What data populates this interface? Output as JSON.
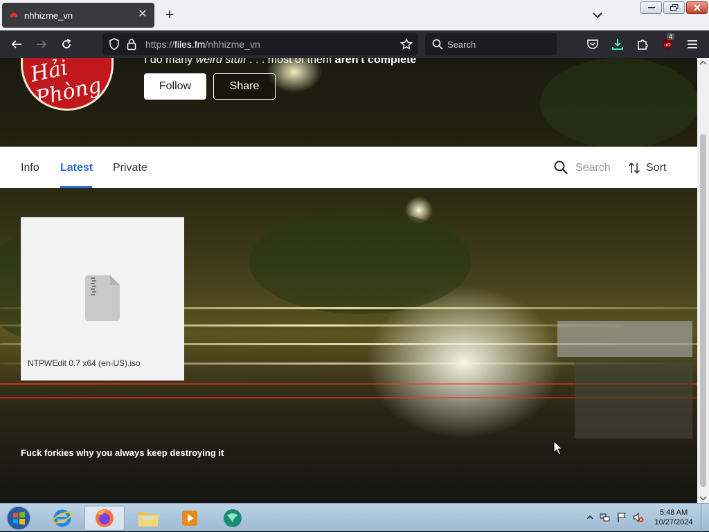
{
  "browser": {
    "tab_title": "nhhizme_vn",
    "url_prefix": "https://",
    "url_host": "files.fm",
    "url_path": "/nhhizme_vn",
    "search_placeholder": "Search",
    "extension_badge": "4"
  },
  "profile": {
    "avatar_text": "Hải Phòng",
    "tagline_prefix": "I do many ",
    "tagline_italic": "weird stuff",
    "tagline_mid": " . . . most of them ",
    "tagline_bold": "aren't complete",
    "follow_label": "Follow",
    "share_label": "Share"
  },
  "tabs": [
    {
      "label": "Info"
    },
    {
      "label": "Latest"
    },
    {
      "label": "Private"
    }
  ],
  "toolbar": {
    "search_label": "Search",
    "sort_label": "Sort"
  },
  "files": [
    {
      "name": "NTPWEdit 0.7 x64 (en-US).iso",
      "icon": "zip-file-icon"
    }
  ],
  "caption": "Fuck forkies why you always keep destroying it",
  "taskbar": {
    "time": "5:48 AM",
    "date": "10/27/2024"
  },
  "colors": {
    "accent": "#2e6bd8",
    "tab_bg": "#3a3a3e",
    "navbar_bg": "#2b2a33"
  }
}
